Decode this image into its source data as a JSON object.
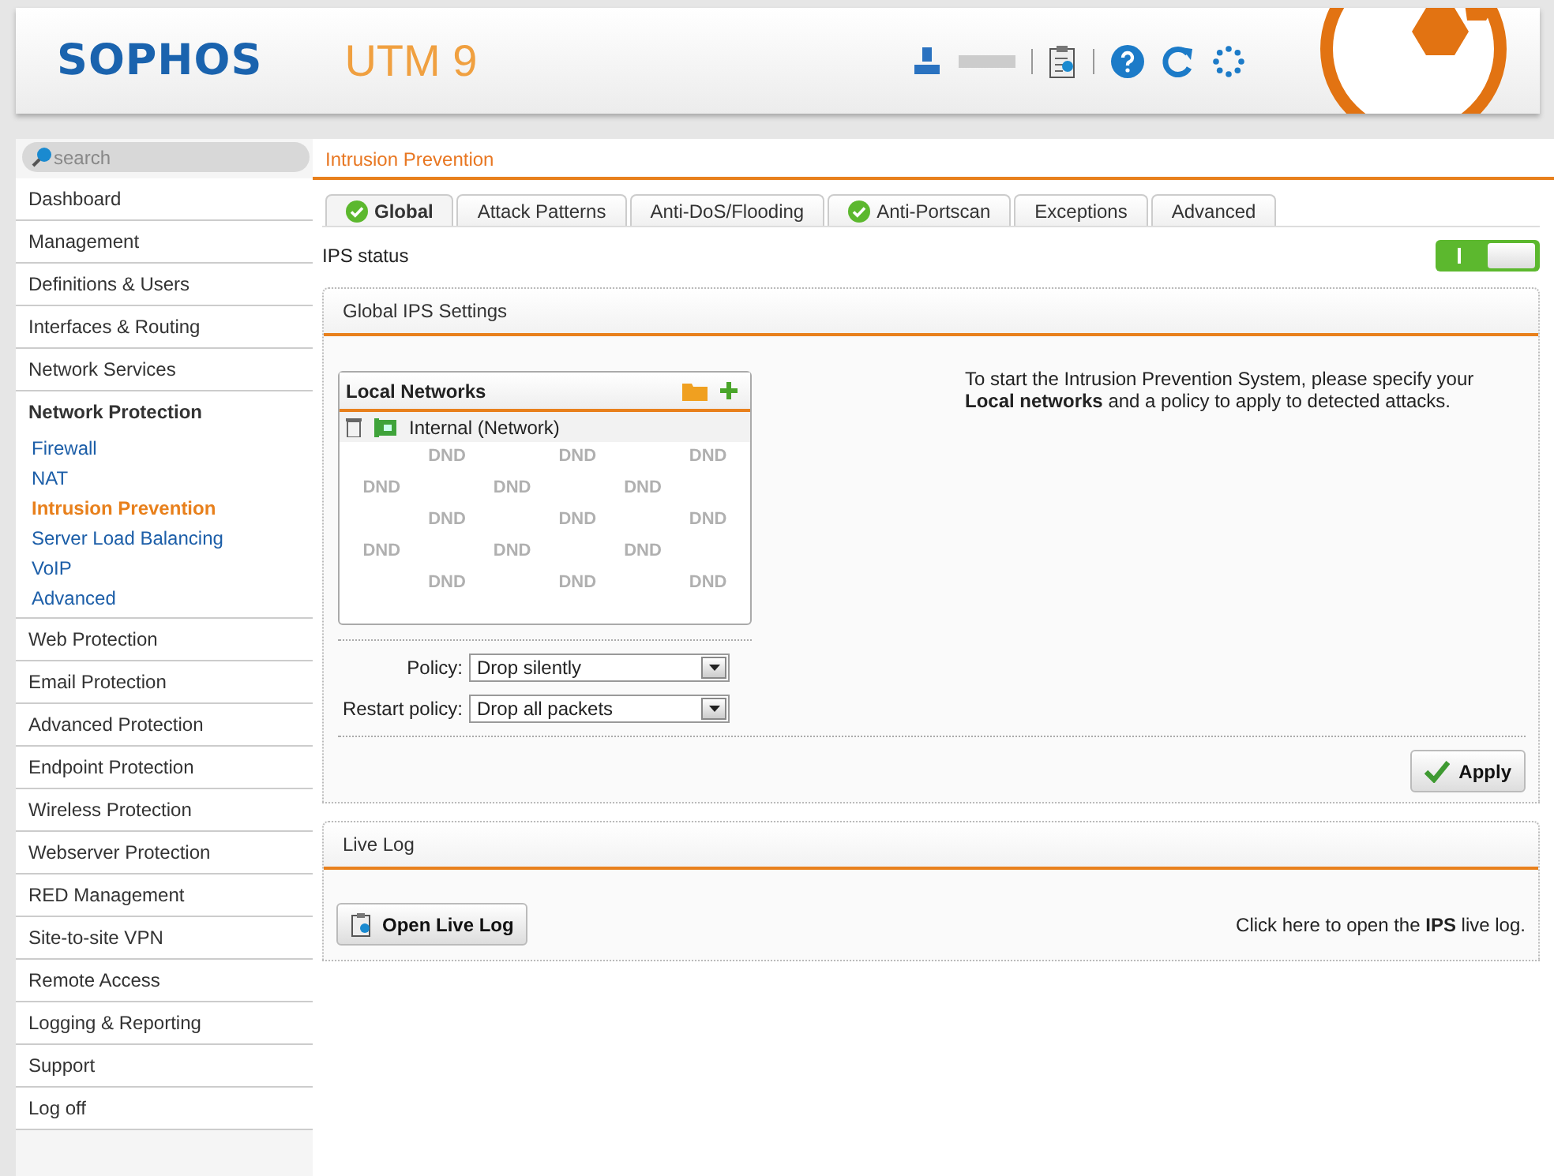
{
  "header": {
    "brand": "SOPHOS",
    "product": "UTM 9"
  },
  "search": {
    "placeholder": "search"
  },
  "sidebar": {
    "items": [
      {
        "label": "Dashboard",
        "selected": false
      },
      {
        "label": "Management",
        "selected": false
      },
      {
        "label": "Definitions & Users",
        "selected": false
      },
      {
        "label": "Interfaces & Routing",
        "selected": false
      },
      {
        "label": "Network Services",
        "selected": false
      },
      {
        "label": "Network Protection",
        "selected": false,
        "expanded": true,
        "children": [
          {
            "label": "Firewall",
            "selected": false
          },
          {
            "label": "NAT",
            "selected": false
          },
          {
            "label": "Intrusion Prevention",
            "selected": true
          },
          {
            "label": "Server Load Balancing",
            "selected": false
          },
          {
            "label": "VoIP",
            "selected": false
          },
          {
            "label": "Advanced",
            "selected": false
          }
        ]
      },
      {
        "label": "Web Protection",
        "selected": false
      },
      {
        "label": "Email Protection",
        "selected": false
      },
      {
        "label": "Advanced Protection",
        "selected": false
      },
      {
        "label": "Endpoint Protection",
        "selected": false
      },
      {
        "label": "Wireless Protection",
        "selected": false
      },
      {
        "label": "Webserver Protection",
        "selected": false
      },
      {
        "label": "RED Management",
        "selected": false
      },
      {
        "label": "Site-to-site VPN",
        "selected": false
      },
      {
        "label": "Remote Access",
        "selected": false
      },
      {
        "label": "Logging & Reporting",
        "selected": false
      },
      {
        "label": "Support",
        "selected": false
      },
      {
        "label": "Log off",
        "selected": false
      }
    ]
  },
  "page_title": "Intrusion Prevention",
  "tabs": [
    {
      "label": "Global",
      "selected": true,
      "checked": true
    },
    {
      "label": "Attack Patterns",
      "selected": false,
      "checked": false
    },
    {
      "label": "Anti-DoS/Flooding",
      "selected": false,
      "checked": false
    },
    {
      "label": "Anti-Portscan",
      "selected": false,
      "checked": true
    },
    {
      "label": "Exceptions",
      "selected": false,
      "checked": false
    },
    {
      "label": "Advanced",
      "selected": false,
      "checked": false
    }
  ],
  "ips_status": {
    "label": "IPS status",
    "on": true
  },
  "global_settings": {
    "title": "Global IPS Settings",
    "local_networks": {
      "title": "Local Networks",
      "entries": [
        "Internal (Network)"
      ],
      "dnd_marks": [
        "DND",
        "DND",
        "DND",
        "DND",
        "DND",
        "DND",
        "DND",
        "DND",
        "DND",
        "DND",
        "DND",
        "DND",
        "DND",
        "DND",
        "DND"
      ]
    },
    "info": "To start the Intrusion Prevention System, please specify your **Local networks** and a policy to apply to detected attacks.",
    "fields": [
      {
        "label": "Policy:",
        "value": "Drop silently"
      },
      {
        "label": "Restart policy:",
        "value": "Drop all packets"
      }
    ],
    "apply_button": "Apply"
  },
  "live_log": {
    "title": "Live Log",
    "button": "Open Live Log",
    "hint": "Click here to open the **IPS** live log."
  }
}
